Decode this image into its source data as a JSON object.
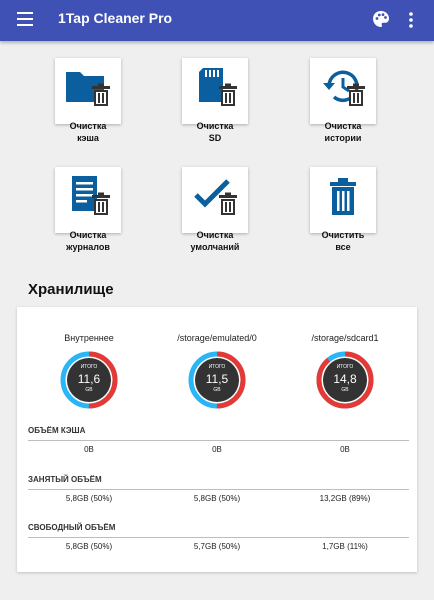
{
  "appbar": {
    "title": "1Tap Cleaner Pro",
    "color": "#3f51b5",
    "menu_icon": "hamburger-icon",
    "palette_icon": "palette-icon",
    "more_icon": "more-vert-icon"
  },
  "tiles": [
    {
      "label": "Очистка\nкэша",
      "icon": "folder-trash-icon"
    },
    {
      "label": "Очистка\nSD",
      "icon": "sdcard-trash-icon"
    },
    {
      "label": "Очистка\nистории",
      "icon": "history-icon"
    },
    {
      "label": "Очистка\nжурналов",
      "icon": "document-trash-icon"
    },
    {
      "label": "Очистка\nумолчаний",
      "icon": "check-trash-icon"
    },
    {
      "label": "Очистить\nвсе",
      "icon": "trash-icon"
    }
  ],
  "accent_color": "#0b5f9e",
  "storage": {
    "title": "Хранилище",
    "columns": [
      {
        "name": "Внутреннее",
        "gauge_label": "ИТОГО",
        "total": "11,6",
        "unit": "GB",
        "used_fraction": 0.5,
        "ring_color": "#29b6f6"
      },
      {
        "name": "/storage/emulated/0",
        "gauge_label": "ИТОГО",
        "total": "11,5",
        "unit": "GB",
        "used_fraction": 0.5,
        "ring_color": "#29b6f6"
      },
      {
        "name": "/storage/sdcard1",
        "gauge_label": "ИТОГО",
        "total": "14,8",
        "unit": "GB",
        "used_fraction": 0.89,
        "ring_color": "#29b6f6"
      }
    ],
    "used_color": "#e53935",
    "rows": [
      {
        "title": "ОБЪЁМ КЭША",
        "values": [
          "0B",
          "0B",
          "0B"
        ]
      },
      {
        "title": "ЗАНЯТЫЙ ОБЪЁМ",
        "values": [
          "5,8GB (50%)",
          "5,8GB (50%)",
          "13,2GB (89%)"
        ]
      },
      {
        "title": "СВОБОДНЫЙ ОБЪЁМ",
        "values": [
          "5,8GB (50%)",
          "5,7GB (50%)",
          "1,7GB (11%)"
        ]
      }
    ]
  }
}
